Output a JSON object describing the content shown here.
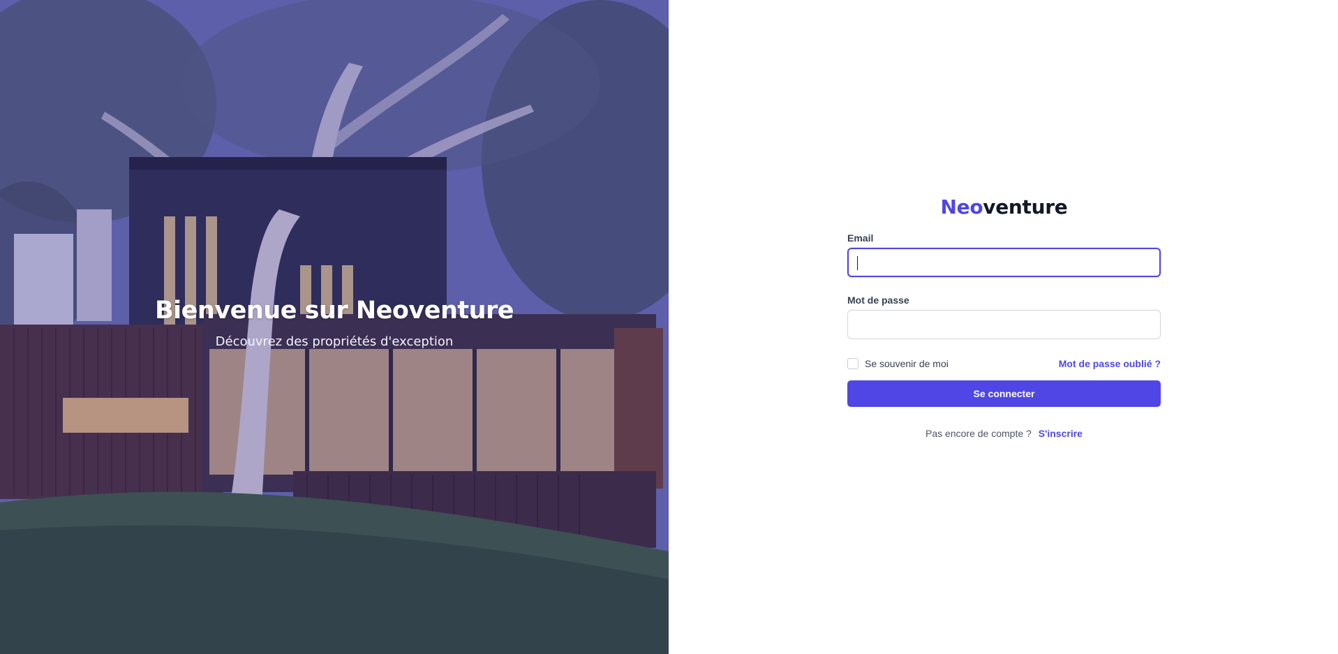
{
  "hero": {
    "title": "Bienvenue sur Neoventure",
    "subtitle": "Découvrez des propriétés d'exception"
  },
  "brand": {
    "name_accent": "Neo",
    "name_rest": "venture",
    "accent_color": "#4f46e5"
  },
  "form": {
    "email_label": "Email",
    "email_value": "",
    "password_label": "Mot de passe",
    "password_value": "",
    "remember_label": "Se souvenir de moi",
    "remember_checked": false,
    "forgot_link": "Mot de passe oublié ?",
    "submit_label": "Se connecter"
  },
  "signup": {
    "prompt": "Pas encore de compte ?",
    "link": "S'inscrire"
  },
  "colors": {
    "primary": "#4f46e5",
    "text": "#111827",
    "muted": "#4b5563"
  }
}
